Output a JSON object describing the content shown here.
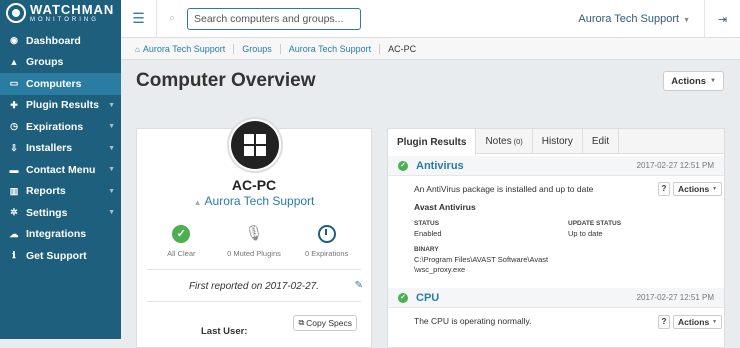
{
  "logo": {
    "brand": "WATCHMAN",
    "sub": "MONITORING"
  },
  "sidebar": {
    "items": [
      {
        "label": "Dashboard",
        "icon": "dashboard-icon",
        "glyph": "◉",
        "caret": false
      },
      {
        "label": "Groups",
        "icon": "groups-icon",
        "glyph": "▲",
        "caret": false
      },
      {
        "label": "Computers",
        "icon": "computer-icon",
        "glyph": "▭",
        "caret": false,
        "active": true
      },
      {
        "label": "Plugin Results",
        "icon": "plugin-icon",
        "glyph": "✚",
        "caret": true
      },
      {
        "label": "Expirations",
        "icon": "clock-icon",
        "glyph": "◷",
        "caret": true
      },
      {
        "label": "Installers",
        "icon": "download-icon",
        "glyph": "⇩",
        "caret": true
      },
      {
        "label": "Contact Menu",
        "icon": "contact-icon",
        "glyph": "▬",
        "caret": true
      },
      {
        "label": "Reports",
        "icon": "chart-icon",
        "glyph": "▥",
        "caret": true
      },
      {
        "label": "Settings",
        "icon": "gear-icon",
        "glyph": "✲",
        "caret": true
      },
      {
        "label": "Integrations",
        "icon": "cloud-icon",
        "glyph": "☁",
        "caret": false
      },
      {
        "label": "Get Support",
        "icon": "info-icon",
        "glyph": "ℹ",
        "caret": false
      }
    ]
  },
  "topbar": {
    "search_placeholder": "Search computers and groups...",
    "user": "Aurora Tech Support"
  },
  "breadcrumb": [
    "Aurora Tech Support",
    "Groups",
    "Aurora Tech Support",
    "AC-PC"
  ],
  "page": {
    "title": "Computer Overview",
    "actions_label": "Actions"
  },
  "computer": {
    "name": "AC-PC",
    "group": "Aurora Tech Support",
    "statuses": [
      {
        "label": "All Clear",
        "icon": "check-circle-icon"
      },
      {
        "label": "0 Muted Plugins",
        "icon": "muted-mic-icon"
      },
      {
        "label": "0 Expirations",
        "icon": "clock-icon"
      }
    ],
    "first_reported": "First reported on 2017-02-27.",
    "last_user_label": "Last User:",
    "copy_specs_label": "Copy Specs"
  },
  "tabs": [
    {
      "label": "Plugin Results",
      "active": true
    },
    {
      "label": "Notes",
      "count": "(0)"
    },
    {
      "label": "History"
    },
    {
      "label": "Edit"
    }
  ],
  "plugins": {
    "antivirus": {
      "name": "Antivirus",
      "time": "2017-02-27 12:51 PM",
      "desc": "An AntiVirus package is installed and up to date",
      "product": "Avast Antivirus",
      "status_label": "STATUS",
      "status_value": "Enabled",
      "update_label": "UPDATE STATUS",
      "update_value": "Up to date",
      "binary_label": "BINARY",
      "binary_line1": "C:\\Program Files\\AVAST Software\\Avast",
      "binary_line2": "\\wsc_proxy.exe"
    },
    "cpu": {
      "name": "CPU",
      "time": "2017-02-27 12:51 PM",
      "desc": "The CPU is operating normally."
    },
    "help_label": "?",
    "actions_label": "Actions"
  },
  "colors": {
    "sidebar": "#1e5f7e",
    "accent": "#2b7ca3",
    "ok": "#4caf50"
  }
}
